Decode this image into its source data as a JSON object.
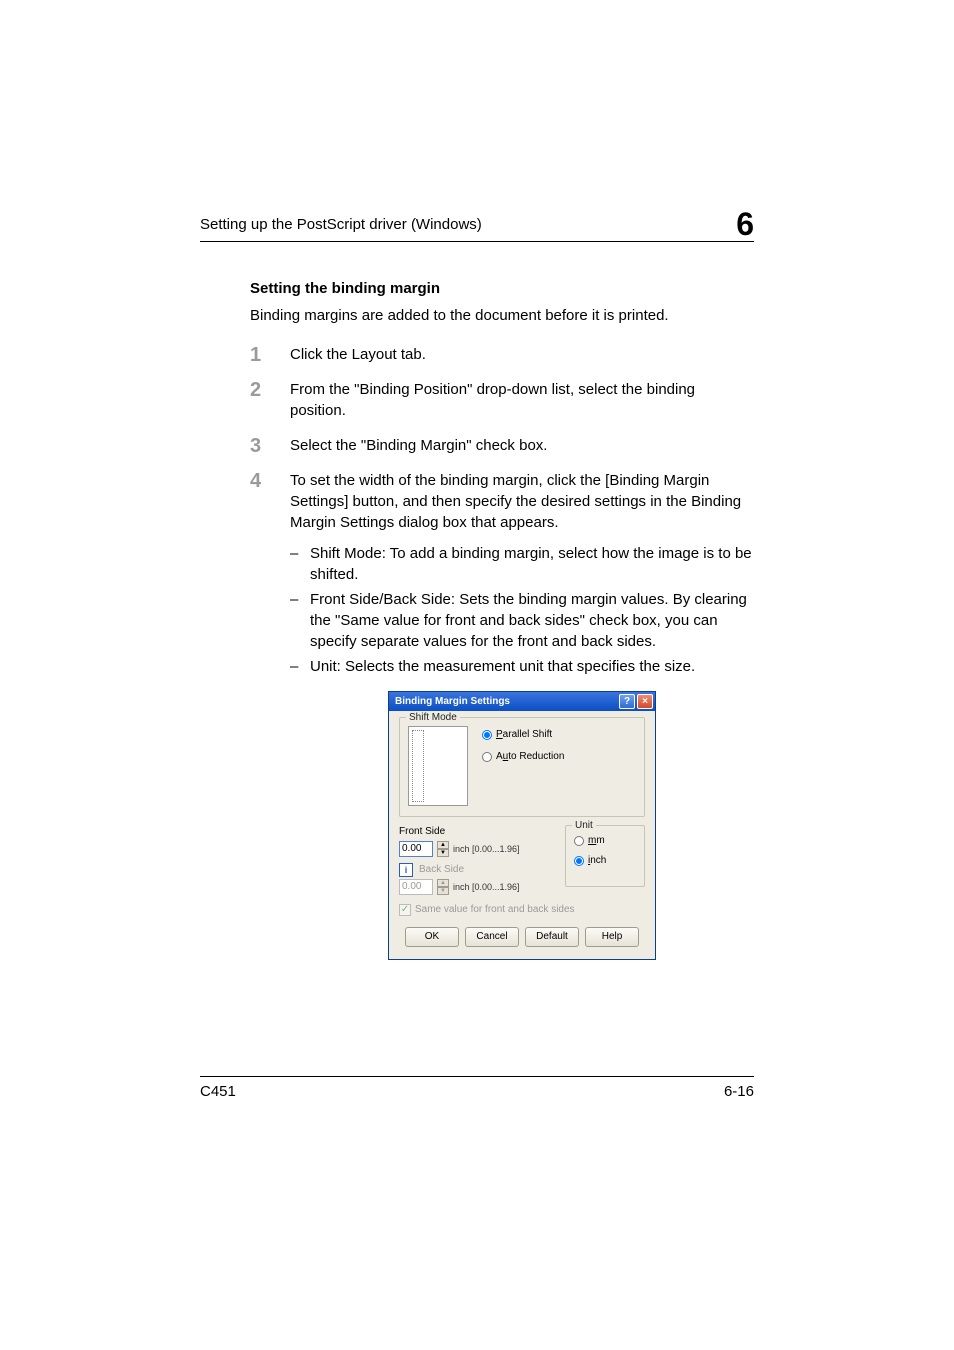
{
  "header": {
    "left": "Setting up the PostScript driver (Windows)",
    "chapter": "6"
  },
  "section": {
    "subheading": "Setting the binding margin",
    "intro": "Binding margins are added to the document before it is printed."
  },
  "steps": [
    {
      "num": "1",
      "text": "Click the Layout tab."
    },
    {
      "num": "2",
      "text": "From the \"Binding Position\" drop-down list, select the binding position."
    },
    {
      "num": "3",
      "text": "Select the \"Binding Margin\" check box."
    },
    {
      "num": "4",
      "text": "To set the width of the binding margin, click the [Binding Margin Settings] button, and then specify the desired settings in the Binding Margin Settings dialog box that appears."
    }
  ],
  "substeps": [
    "Shift Mode: To add a binding margin, select how the image is to be shifted.",
    "Front Side/Back Side: Sets the binding margin values. By clearing the \"Same value for front and back sides\" check box, you can specify separate values for the front and back sides.",
    "Unit: Selects the measurement unit that specifies the size."
  ],
  "dialog": {
    "title": "Binding Margin Settings",
    "shift_mode_label": "Shift Mode",
    "radio_parallel": "Parallel Shift",
    "radio_auto": "Auto Reduction",
    "front_side_label": "Front Side",
    "front_value": "0.00",
    "front_range": "inch [0.00...1.96]",
    "back_side_label": "Back Side",
    "back_value": "0.00",
    "back_range": "inch [0.00...1.96]",
    "unit_label": "Unit",
    "unit_mm": "mm",
    "unit_inch": "inch",
    "same_value": "Same value for front and back sides",
    "ok": "OK",
    "cancel": "Cancel",
    "default": "Default",
    "help": "Help"
  },
  "footer": {
    "left": "C451",
    "right": "6-16"
  }
}
